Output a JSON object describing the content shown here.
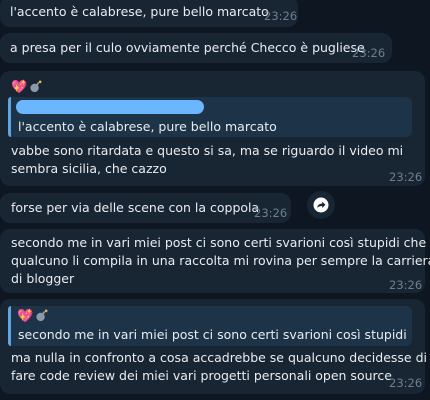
{
  "messages": [
    {
      "text": "l'accento è calabrese, pure bello marcato",
      "time": "23:26"
    },
    {
      "text": "a presa per il culo ovviamente perché Checco è pugliese",
      "time": "23:26"
    },
    {
      "sender_emoji": "💖",
      "sender_icon": "bomb-icon",
      "reply_quote": "l'accento è calabrese, pure bello marcato",
      "lines": [
        "vabbe sono ritardata e questo si sa, ma se riguardo il video mi",
        "sembra sicilia, che cazzo"
      ],
      "time": "23:26"
    },
    {
      "text": "forse per via delle scene con la coppola",
      "time": "23:26"
    },
    {
      "lines": [
        "secondo me in vari miei post ci sono certi svarioni così stupidi che se",
        "qualcuno li compila in una raccolta mi rovina per sempre la carriera",
        "di blogger"
      ],
      "time": "23:26"
    },
    {
      "reply_emoji": "💖",
      "reply_icon": "bomb-icon",
      "reply_quote": "secondo me in vari miei post ci sono certi svarioni così stupidi ch...",
      "lines": [
        "ma nulla in confronto a cosa accadrebbe se qualcuno decidesse di",
        "fare code review dei miei vari progetti personali open source"
      ],
      "time": "23:26"
    }
  ],
  "forward_button": {
    "icon": "forward-arrow-icon"
  },
  "colors": {
    "background": "#0e1621",
    "bubble": "#182533",
    "accent": "#5fa5e0",
    "text": "#e9edf1",
    "time": "#6d7f8f"
  }
}
